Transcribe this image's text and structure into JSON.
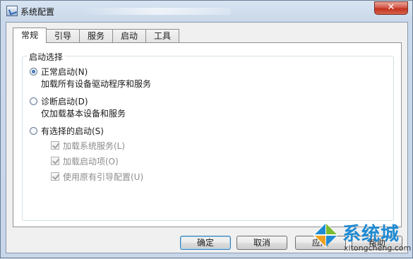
{
  "window": {
    "title": "系统配置",
    "close_glyph": "✕",
    "icon": "msconfig-icon"
  },
  "tabs": [
    {
      "label": "常规",
      "active": true
    },
    {
      "label": "引导",
      "active": false
    },
    {
      "label": "服务",
      "active": false
    },
    {
      "label": "启动",
      "active": false
    },
    {
      "label": "工具",
      "active": false
    }
  ],
  "startup_selection": {
    "title": "启动选择",
    "normal": {
      "label": "正常启动(N)",
      "description": "加载所有设备驱动程序和服务",
      "checked": true
    },
    "diagnostic": {
      "label": "诊断启动(D)",
      "description": "仅加载基本设备和服务",
      "checked": false
    },
    "selective": {
      "label": "有选择的启动(S)",
      "checked": false,
      "options": [
        {
          "label": "加载系统服务(L)",
          "checked": true,
          "enabled": false
        },
        {
          "label": "加载启动项(O)",
          "checked": true,
          "enabled": false
        },
        {
          "label": "使用原有引导配置(U)",
          "checked": true,
          "enabled": false
        }
      ]
    }
  },
  "buttons": {
    "ok": "确定",
    "cancel": "取消",
    "apply": "应用",
    "help": "帮助"
  },
  "watermark": {
    "text": "系统城",
    "url": "xitongcheng.com"
  },
  "colors": {
    "accent_blue": "#1f8bd3",
    "close_red": "#c2321f",
    "watermark_green": "#7dbb2f"
  }
}
